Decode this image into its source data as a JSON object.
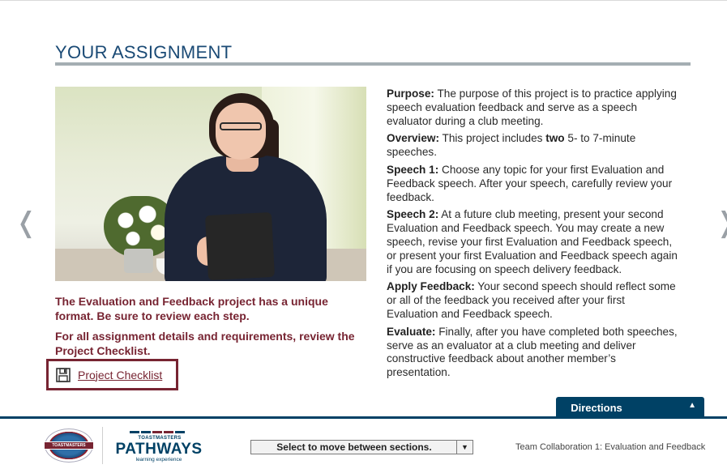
{
  "assignment": {
    "title": "YOUR ASSIGNMENT",
    "note1": "The Evaluation and Feedback project has a unique format. Be sure to review each step.",
    "note2": "For all assignment details and requirements, review the Project Checklist.",
    "checklist_link": "Project Checklist",
    "checklist_icon": "save-disk-icon"
  },
  "nav": {
    "prev_glyph": "❬",
    "next_glyph": "❭"
  },
  "content": [
    {
      "label": "Purpose:",
      "text": " The purpose of this project is to practice applying speech evaluation feedback and serve as a speech evaluator during a club meeting."
    },
    {
      "label": "Overview:",
      "text_before": " This project includes ",
      "emph": "two",
      "text_after": " 5- to 7-minute speeches."
    },
    {
      "label": "Speech 1:",
      "text": " Choose any topic for your first Evaluation and Feedback speech. After your speech, carefully review your feedback."
    },
    {
      "label": "Speech 2:",
      "text": " At a future club meeting, present your second Evaluation and Feedback speech. You may create a new speech, revise your first Evaluation and Feedback speech, or present your first Evaluation and Feedback speech again if you are focusing on speech delivery feedback."
    },
    {
      "label": "Apply Feedback:",
      "text": " Your second speech should reflect some or all of the feedback you received after your first Evaluation and Feedback speech."
    },
    {
      "label": "Evaluate:",
      "text": " Finally, after you have completed both speeches, serve as an evaluator at a club meeting and deliver constructive feedback about another member’s presentation."
    }
  ],
  "directions": {
    "label": "Directions",
    "arrow": "▲"
  },
  "footer": {
    "tm_logo_text": "TOASTMASTERS",
    "pathways_small": "TOASTMASTERS",
    "pathways_big": "PATHWAYS",
    "pathways_sub": "learning experience",
    "select_value": "Select to move between sections.",
    "select_arrow": "▼",
    "course_title": "Team Collaboration 1: Evaluation and Feedback",
    "dash_colors": [
      "#004165",
      "#004165",
      "#772432",
      "#772432",
      "#004165"
    ]
  },
  "colors": {
    "brand_blue": "#004165",
    "brand_maroon": "#772432",
    "title_blue": "#1a4a75"
  }
}
